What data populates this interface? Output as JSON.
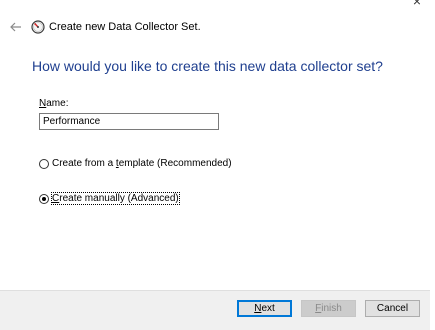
{
  "window": {
    "title": "Create new Data Collector Set.",
    "close_glyph": "×"
  },
  "heading": "How would you like to create this new data collector set?",
  "name_field": {
    "label": "Name:",
    "value": "Performance"
  },
  "options": [
    {
      "label": "Create from a template (Recommended)",
      "selected": false
    },
    {
      "label": "Create manually (Advanced)",
      "selected": true
    }
  ],
  "buttons": {
    "next": "Next",
    "finish": "Finish",
    "cancel": "Cancel"
  },
  "icons": {
    "back": "back-arrow-icon",
    "app": "data-collector-gauge-icon",
    "close": "close-icon"
  },
  "colors": {
    "heading": "#1f3f8f",
    "default_button_border": "#0078d7",
    "footer_bg": "#f0f0f0"
  }
}
